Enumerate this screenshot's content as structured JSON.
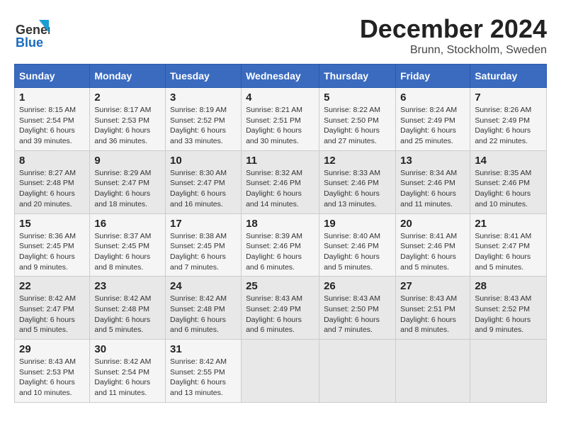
{
  "header": {
    "logo_line1": "General",
    "logo_line2": "Blue",
    "month": "December 2024",
    "location": "Brunn, Stockholm, Sweden"
  },
  "days_of_week": [
    "Sunday",
    "Monday",
    "Tuesday",
    "Wednesday",
    "Thursday",
    "Friday",
    "Saturday"
  ],
  "weeks": [
    [
      {
        "day": 1,
        "sunrise": "8:15 AM",
        "sunset": "2:54 PM",
        "daylight": "6 hours and 39 minutes."
      },
      {
        "day": 2,
        "sunrise": "8:17 AM",
        "sunset": "2:53 PM",
        "daylight": "6 hours and 36 minutes."
      },
      {
        "day": 3,
        "sunrise": "8:19 AM",
        "sunset": "2:52 PM",
        "daylight": "6 hours and 33 minutes."
      },
      {
        "day": 4,
        "sunrise": "8:21 AM",
        "sunset": "2:51 PM",
        "daylight": "6 hours and 30 minutes."
      },
      {
        "day": 5,
        "sunrise": "8:22 AM",
        "sunset": "2:50 PM",
        "daylight": "6 hours and 27 minutes."
      },
      {
        "day": 6,
        "sunrise": "8:24 AM",
        "sunset": "2:49 PM",
        "daylight": "6 hours and 25 minutes."
      },
      {
        "day": 7,
        "sunrise": "8:26 AM",
        "sunset": "2:49 PM",
        "daylight": "6 hours and 22 minutes."
      }
    ],
    [
      {
        "day": 8,
        "sunrise": "8:27 AM",
        "sunset": "2:48 PM",
        "daylight": "6 hours and 20 minutes."
      },
      {
        "day": 9,
        "sunrise": "8:29 AM",
        "sunset": "2:47 PM",
        "daylight": "6 hours and 18 minutes."
      },
      {
        "day": 10,
        "sunrise": "8:30 AM",
        "sunset": "2:47 PM",
        "daylight": "6 hours and 16 minutes."
      },
      {
        "day": 11,
        "sunrise": "8:32 AM",
        "sunset": "2:46 PM",
        "daylight": "6 hours and 14 minutes."
      },
      {
        "day": 12,
        "sunrise": "8:33 AM",
        "sunset": "2:46 PM",
        "daylight": "6 hours and 13 minutes."
      },
      {
        "day": 13,
        "sunrise": "8:34 AM",
        "sunset": "2:46 PM",
        "daylight": "6 hours and 11 minutes."
      },
      {
        "day": 14,
        "sunrise": "8:35 AM",
        "sunset": "2:46 PM",
        "daylight": "6 hours and 10 minutes."
      }
    ],
    [
      {
        "day": 15,
        "sunrise": "8:36 AM",
        "sunset": "2:45 PM",
        "daylight": "6 hours and 9 minutes."
      },
      {
        "day": 16,
        "sunrise": "8:37 AM",
        "sunset": "2:45 PM",
        "daylight": "6 hours and 8 minutes."
      },
      {
        "day": 17,
        "sunrise": "8:38 AM",
        "sunset": "2:45 PM",
        "daylight": "6 hours and 7 minutes."
      },
      {
        "day": 18,
        "sunrise": "8:39 AM",
        "sunset": "2:46 PM",
        "daylight": "6 hours and 6 minutes."
      },
      {
        "day": 19,
        "sunrise": "8:40 AM",
        "sunset": "2:46 PM",
        "daylight": "6 hours and 5 minutes."
      },
      {
        "day": 20,
        "sunrise": "8:41 AM",
        "sunset": "2:46 PM",
        "daylight": "6 hours and 5 minutes."
      },
      {
        "day": 21,
        "sunrise": "8:41 AM",
        "sunset": "2:47 PM",
        "daylight": "6 hours and 5 minutes."
      }
    ],
    [
      {
        "day": 22,
        "sunrise": "8:42 AM",
        "sunset": "2:47 PM",
        "daylight": "6 hours and 5 minutes."
      },
      {
        "day": 23,
        "sunrise": "8:42 AM",
        "sunset": "2:48 PM",
        "daylight": "6 hours and 5 minutes."
      },
      {
        "day": 24,
        "sunrise": "8:42 AM",
        "sunset": "2:48 PM",
        "daylight": "6 hours and 6 minutes."
      },
      {
        "day": 25,
        "sunrise": "8:43 AM",
        "sunset": "2:49 PM",
        "daylight": "6 hours and 6 minutes."
      },
      {
        "day": 26,
        "sunrise": "8:43 AM",
        "sunset": "2:50 PM",
        "daylight": "6 hours and 7 minutes."
      },
      {
        "day": 27,
        "sunrise": "8:43 AM",
        "sunset": "2:51 PM",
        "daylight": "6 hours and 8 minutes."
      },
      {
        "day": 28,
        "sunrise": "8:43 AM",
        "sunset": "2:52 PM",
        "daylight": "6 hours and 9 minutes."
      }
    ],
    [
      {
        "day": 29,
        "sunrise": "8:43 AM",
        "sunset": "2:53 PM",
        "daylight": "6 hours and 10 minutes."
      },
      {
        "day": 30,
        "sunrise": "8:42 AM",
        "sunset": "2:54 PM",
        "daylight": "6 hours and 11 minutes."
      },
      {
        "day": 31,
        "sunrise": "8:42 AM",
        "sunset": "2:55 PM",
        "daylight": "6 hours and 13 minutes."
      },
      null,
      null,
      null,
      null
    ]
  ]
}
